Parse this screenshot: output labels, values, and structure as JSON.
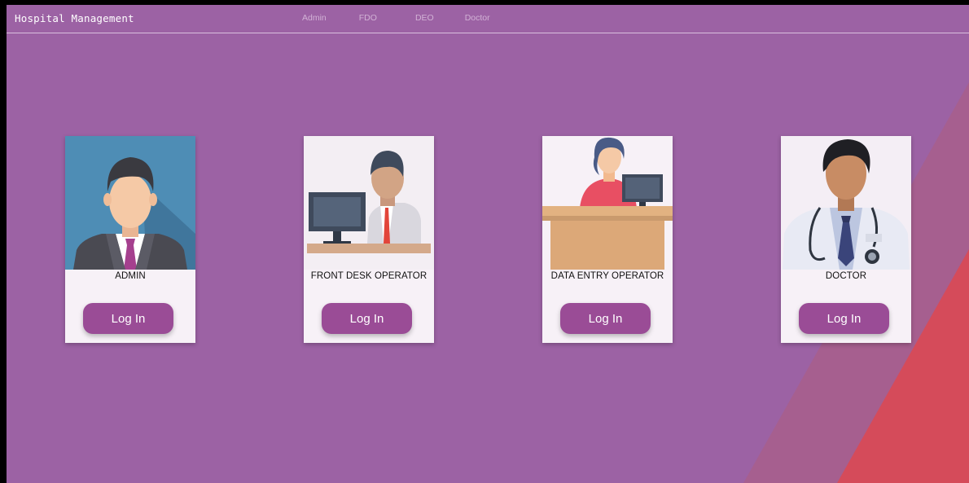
{
  "navbar": {
    "brand": "Hospital Management",
    "links": [
      {
        "label": "Admin"
      },
      {
        "label": "FDO"
      },
      {
        "label": "DEO"
      },
      {
        "label": "Doctor"
      }
    ]
  },
  "cards": [
    {
      "title": "ADMIN",
      "button": "Log In",
      "illustration": "admin-avatar-icon"
    },
    {
      "title": "FRONT DESK OPERATOR",
      "button": "Log In",
      "illustration": "front-desk-operator-icon"
    },
    {
      "title": "DATA ENTRY OPERATOR",
      "button": "Log In",
      "illustration": "data-entry-operator-icon"
    },
    {
      "title": "DOCTOR",
      "button": "Log In",
      "illustration": "doctor-avatar-icon"
    }
  ],
  "colors": {
    "background": "#9c62a4",
    "button": "#9a4c96",
    "accent_stripe": "#d54b5a"
  }
}
